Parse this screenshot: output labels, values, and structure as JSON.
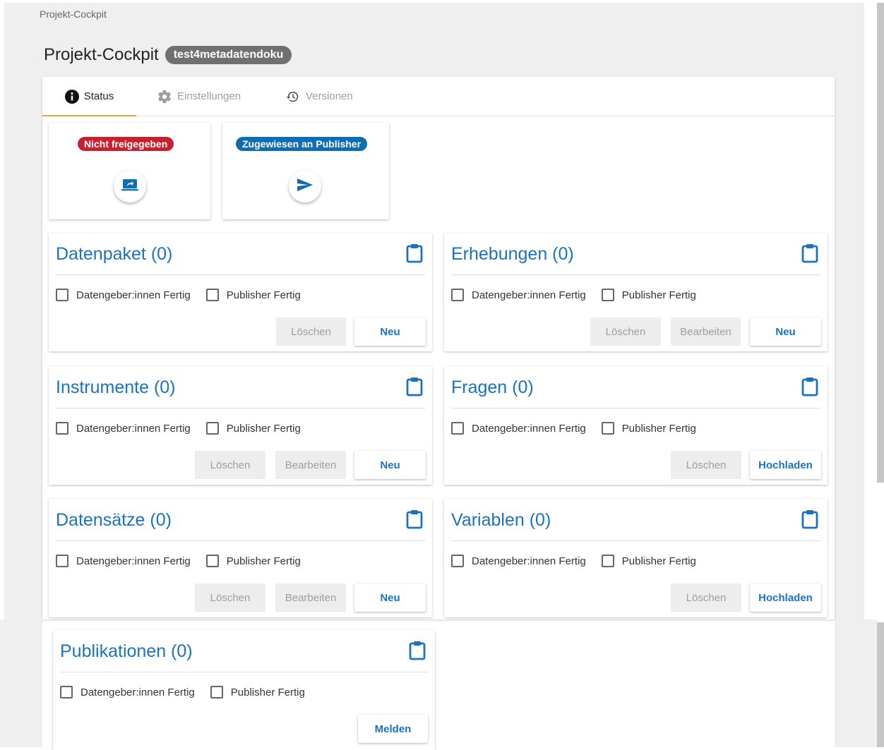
{
  "breadcrumb": "Projekt-Cockpit",
  "page": {
    "title": "Projekt-Cockpit",
    "project_chip": "test4metadatendoku"
  },
  "tabs": [
    {
      "label": "Status",
      "icon": "info-icon",
      "active": true
    },
    {
      "label": "Einstellungen",
      "icon": "gear-icon",
      "active": false
    },
    {
      "label": "Versionen",
      "icon": "history-icon",
      "active": false
    }
  ],
  "status_cards": [
    {
      "badge": "Nicht freigegeben",
      "badge_color": "#c8202f",
      "icon": "publish-screen-icon"
    },
    {
      "badge": "Zugewiesen an Publisher",
      "badge_color": "#0f6db4",
      "icon": "send-icon"
    }
  ],
  "common": {
    "checkbox_data_provider": "Datengeber:innen Fertig",
    "checkbox_publisher": "Publisher Fertig",
    "btn_delete": "Löschen",
    "btn_edit": "Bearbeiten",
    "btn_new": "Neu",
    "btn_upload": "Hochladen",
    "btn_report": "Melden"
  },
  "sections": {
    "datenpaket": {
      "title": "Datenpaket (0)"
    },
    "erhebungen": {
      "title": "Erhebungen (0)"
    },
    "instrumente": {
      "title": "Instrumente (0)"
    },
    "fragen": {
      "title": "Fragen (0)"
    },
    "datensaetze": {
      "title": "Datensätze (0)"
    },
    "variablen": {
      "title": "Variablen (0)"
    },
    "publikationen": {
      "title": "Publikationen (0)"
    }
  },
  "colors": {
    "accent_blue": "#1a73c1",
    "tab_indicator": "#e8a33c",
    "chip_gray": "#707070"
  }
}
